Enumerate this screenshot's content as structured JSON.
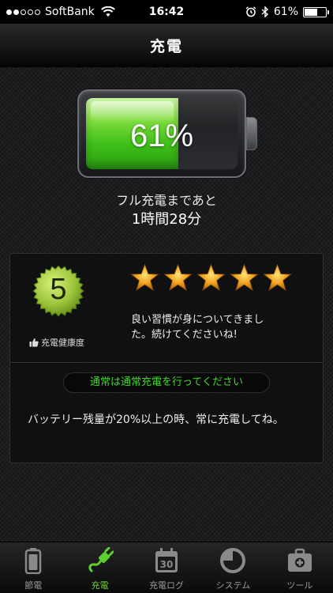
{
  "status_bar": {
    "carrier": "SoftBank",
    "time": "16:42",
    "battery_percent": "61%",
    "battery_level": 0.61,
    "signal_bars_filled": 2,
    "signal_bars_total": 5,
    "icons": [
      "wifi-icon",
      "alarm-icon",
      "bluetooth-icon",
      "battery-icon"
    ]
  },
  "nav": {
    "title": "充電"
  },
  "battery": {
    "percent_text": "61%",
    "level": 0.61,
    "remaining_label": "フル充電まであと",
    "remaining_value": "1時間28分",
    "fill_color": "#5fd12c"
  },
  "health": {
    "score": "5",
    "label": "充電健康度",
    "star_count": 5,
    "star_max": 5,
    "message_line1": "良い習慣が身についてきまし",
    "message_line2": "た。続けてくださいね!"
  },
  "advice": {
    "title": "通常は通常充電を行ってください",
    "description": "バッテリー残量が20%以上の時、常に充電してね。",
    "accent": "#3fd92a"
  },
  "tabs": [
    {
      "label": "節電",
      "icon": "battery-icon",
      "active": false
    },
    {
      "label": "充電",
      "icon": "plug-icon",
      "active": true
    },
    {
      "label": "充電ログ",
      "icon": "calendar-icon",
      "icon_text": "30",
      "active": false
    },
    {
      "label": "システム",
      "icon": "pie-chart-icon",
      "active": false
    },
    {
      "label": "ツール",
      "icon": "toolbox-icon",
      "active": false
    }
  ],
  "colors": {
    "active_tab": "#6fd23c",
    "inactive_tab": "#9a9a9a"
  }
}
